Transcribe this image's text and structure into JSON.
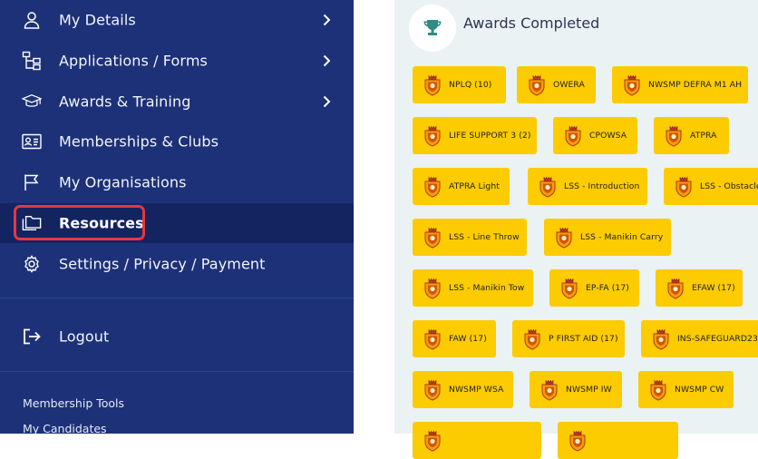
{
  "sidebar": {
    "items": [
      {
        "label": "My Details",
        "icon": "user-icon",
        "chevron": true
      },
      {
        "label": "Applications / Forms",
        "icon": "sitemap-icon",
        "chevron": true
      },
      {
        "label": "Awards & Training",
        "icon": "graduation-cap-icon",
        "chevron": true
      },
      {
        "label": "Memberships & Clubs",
        "icon": "id-card-icon",
        "chevron": false
      },
      {
        "label": "My Organisations",
        "icon": "flag-icon",
        "chevron": false
      },
      {
        "label": "Resources",
        "icon": "folders-icon",
        "chevron": false,
        "active": true
      },
      {
        "label": "Settings / Privacy / Payment",
        "icon": "gear-icon",
        "chevron": false
      }
    ],
    "logout": {
      "label": "Logout",
      "icon": "logout-icon"
    },
    "tools": [
      "Membership Tools",
      "My Candidates"
    ]
  },
  "awards": {
    "title": "Awards Completed",
    "icon": "trophy-icon",
    "badges": [
      "NPLQ (10)",
      "OWERA",
      "NWSMP DEFRA M1 AH",
      "LIFE SUPPORT 3 (2)",
      "CPOWSA",
      "ATPRA",
      "ATPRA Light",
      "LSS - Introduction",
      "LSS - Obstacles",
      "LSS - Line Throw",
      "LSS - Manikin Carry",
      "LSS - Manikin Tow",
      "EP-FA (17)",
      "EFAW (17)",
      "FAW (17)",
      "P FIRST AID (17)",
      "INS-SAFEGUARD23",
      "NWSMP WSA",
      "NWSMP IW",
      "NWSMP CW",
      "",
      ""
    ]
  },
  "colors": {
    "sidebar_bg": "#1d3178",
    "sidebar_active_bg": "#132461",
    "highlight": "#e4383f",
    "badge": "#fccb00",
    "panel_bg": "#ebf2f3",
    "trophy": "#2e8b86"
  }
}
